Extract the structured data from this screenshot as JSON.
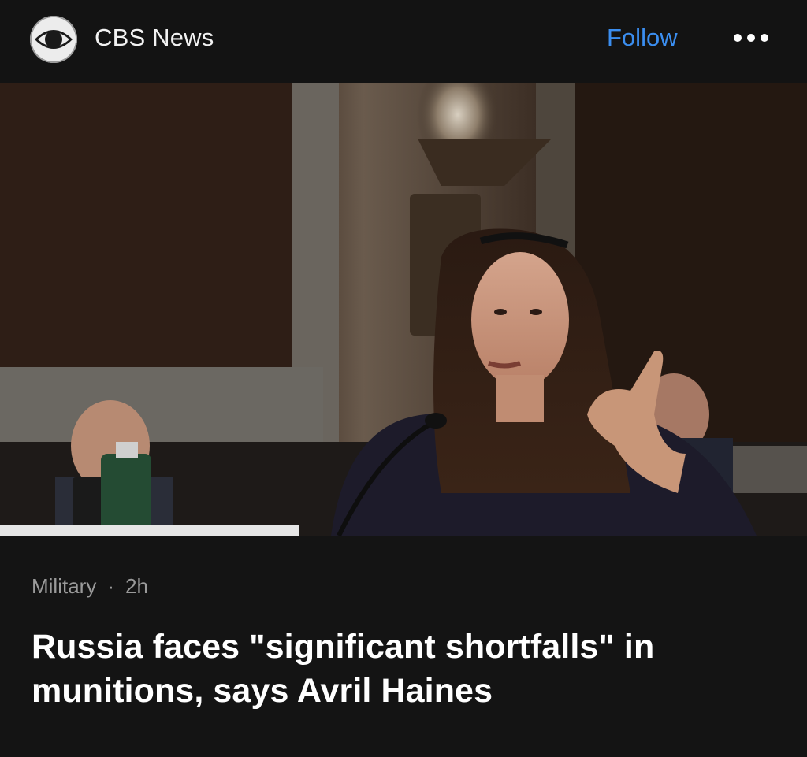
{
  "source": {
    "name": "CBS News",
    "logo_icon": "cbs-eye-icon"
  },
  "header": {
    "follow_label": "Follow",
    "more_icon": "more-horizontal-icon"
  },
  "article": {
    "category": "Military",
    "separator": "·",
    "age": "2h",
    "headline": "Russia faces \"significant shortfalls\" in munitions, says Avril Haines",
    "image_description_icon": "article-photo"
  },
  "colors": {
    "background": "#141414",
    "accent": "#3b8ef0",
    "meta_text": "#9a9a9a",
    "headline_text": "#ffffff"
  }
}
